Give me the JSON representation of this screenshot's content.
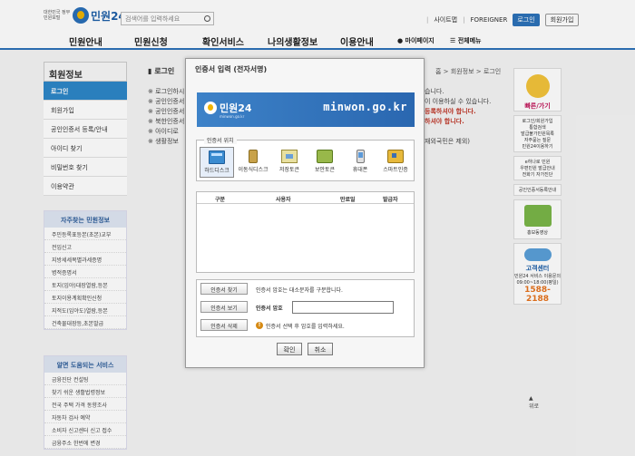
{
  "header": {
    "logo_small": "대한민국 정부민원포털",
    "logo_name": "민원24",
    "search_placeholder": "검색어를 입력하세요",
    "links": [
      "사이트맵",
      "FOREIGNER"
    ],
    "login": "로그인",
    "join": "회원가입"
  },
  "gnb": {
    "items": [
      "민원안내",
      "민원신청",
      "확인서비스",
      "나의생활정보",
      "이용안내"
    ],
    "mypage": "마이페이지",
    "allmenu": "전체메뉴"
  },
  "sidebar": {
    "title": "회원정보",
    "items": [
      "로그인",
      "회원가입",
      "공인인증서 등록/안내",
      "아이디 찾기",
      "비밀번호 찾기",
      "이용약관"
    ]
  },
  "freq_box": {
    "title": "자주찾는 민원정보",
    "items": [
      "주민등록표등본(초본)교부",
      "전입신고",
      "지방세세목별과세증명",
      "병적증명서",
      "토지(임야)대장열람,등본",
      "토지이용계획확인신청",
      "지적도(임야도)열람,등본",
      "건축물대장등,초본발급"
    ]
  },
  "useful_box": {
    "title": "알면 도움되는 서비스",
    "items": [
      "금융진단 컨설팅",
      "찾기 쉬운 생활법령정보",
      "전국 주택 가격 동향조사",
      "자동차 검사 예약",
      "소비자 신고센터 신고 접수",
      "금융주소 한번에 변경"
    ]
  },
  "content": {
    "title": "로그인",
    "breadcrumb": "홈 > 회원정보 > 로그인",
    "lines": [
      "로그인하시",
      "공인인증서",
      "공인인증서",
      "북한인증서",
      "아이디로",
      "생활정보"
    ],
    "right_lines": [
      "습니다.",
      "이 이용하실 수 있습니다.",
      "등록하셔야 합니다.",
      "하셔야 합니다.",
      "재외국민은 제외)"
    ]
  },
  "right_quick": {
    "title": "빠른/가기",
    "links": [
      "로그인/회원가입",
      "통합검색",
      "발급불가민원목록",
      "자주묻는 질문",
      "민원24이용하기"
    ],
    "links2": [
      "e하나로 민원",
      "우편민원 발급안내",
      "전화기 자가진단"
    ],
    "links3": [
      "공인인증서등록안내"
    ],
    "promo": "홍보동영상",
    "center": "고객센터",
    "center_sub": "민원24 서비스 이용문의",
    "hours": "09:00~18:00(평일)",
    "phone": "1588-2188",
    "top": "위로"
  },
  "modal": {
    "title": "인증서 입력 (전자서명)",
    "banner_name": "민원24",
    "banner_sub": "minwon.go.kr",
    "banner_url": "minwon.go.kr",
    "location_legend": "인증서 위치",
    "locations": [
      "하드디스크",
      "이동식디스크",
      "저장토큰",
      "보안토큰",
      "휴대폰",
      "스마트인증"
    ],
    "columns": [
      "구분",
      "사용자",
      "만료일",
      "발급자"
    ],
    "find_btn": "인증서 찾기",
    "find_note": "인증서 암호는 대소문자를 구분합니다.",
    "view_btn": "인증서 보기",
    "pw_label": "인증서 암호",
    "delete_btn": "인증서 삭제",
    "warn_note": "인증서 선택 후 암호를 입력하세요.",
    "ok": "확인",
    "cancel": "취소"
  }
}
